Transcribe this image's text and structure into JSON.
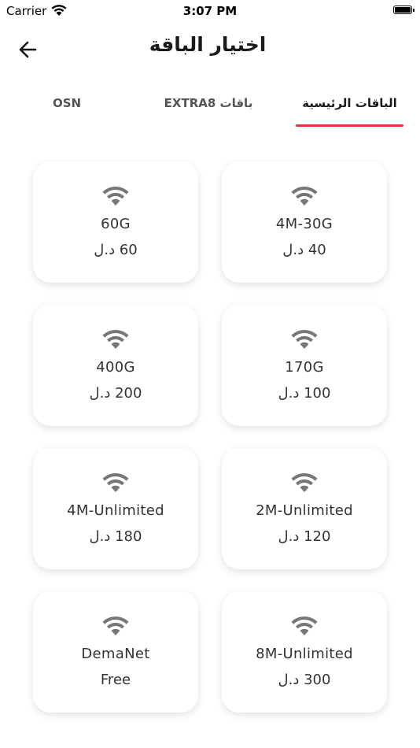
{
  "status": {
    "carrier": "Carrier",
    "time": "3:07 PM"
  },
  "header": {
    "title": "اختيار الباقة"
  },
  "tabs": [
    {
      "label": "OSN"
    },
    {
      "label": "باقات EXTRA8"
    },
    {
      "label": "الباقات الرئيسية"
    }
  ],
  "colors": {
    "accent": "#e0333e",
    "icon": "#777777"
  },
  "packages": [
    {
      "name": "4M-30G",
      "price": "40 د.ل"
    },
    {
      "name": "60G",
      "price": "60 د.ل"
    },
    {
      "name": "170G",
      "price": "100 د.ل"
    },
    {
      "name": "400G",
      "price": "200 د.ل"
    },
    {
      "name": "2M-Unlimited",
      "price": "120 د.ل"
    },
    {
      "name": "4M-Unlimited",
      "price": "180 د.ل"
    },
    {
      "name": "8M-Unlimited",
      "price": "300 د.ل"
    },
    {
      "name": "DemaNet",
      "price": "Free"
    }
  ]
}
